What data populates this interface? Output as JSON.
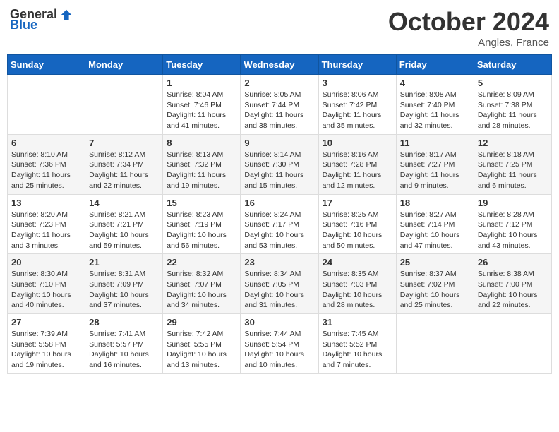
{
  "header": {
    "logo_general": "General",
    "logo_blue": "Blue",
    "month_title": "October 2024",
    "subtitle": "Angles, France"
  },
  "weekdays": [
    "Sunday",
    "Monday",
    "Tuesday",
    "Wednesday",
    "Thursday",
    "Friday",
    "Saturday"
  ],
  "weeks": [
    [
      {
        "day": "",
        "info": ""
      },
      {
        "day": "",
        "info": ""
      },
      {
        "day": "1",
        "info": "Sunrise: 8:04 AM\nSunset: 7:46 PM\nDaylight: 11 hours and 41 minutes."
      },
      {
        "day": "2",
        "info": "Sunrise: 8:05 AM\nSunset: 7:44 PM\nDaylight: 11 hours and 38 minutes."
      },
      {
        "day": "3",
        "info": "Sunrise: 8:06 AM\nSunset: 7:42 PM\nDaylight: 11 hours and 35 minutes."
      },
      {
        "day": "4",
        "info": "Sunrise: 8:08 AM\nSunset: 7:40 PM\nDaylight: 11 hours and 32 minutes."
      },
      {
        "day": "5",
        "info": "Sunrise: 8:09 AM\nSunset: 7:38 PM\nDaylight: 11 hours and 28 minutes."
      }
    ],
    [
      {
        "day": "6",
        "info": "Sunrise: 8:10 AM\nSunset: 7:36 PM\nDaylight: 11 hours and 25 minutes."
      },
      {
        "day": "7",
        "info": "Sunrise: 8:12 AM\nSunset: 7:34 PM\nDaylight: 11 hours and 22 minutes."
      },
      {
        "day": "8",
        "info": "Sunrise: 8:13 AM\nSunset: 7:32 PM\nDaylight: 11 hours and 19 minutes."
      },
      {
        "day": "9",
        "info": "Sunrise: 8:14 AM\nSunset: 7:30 PM\nDaylight: 11 hours and 15 minutes."
      },
      {
        "day": "10",
        "info": "Sunrise: 8:16 AM\nSunset: 7:28 PM\nDaylight: 11 hours and 12 minutes."
      },
      {
        "day": "11",
        "info": "Sunrise: 8:17 AM\nSunset: 7:27 PM\nDaylight: 11 hours and 9 minutes."
      },
      {
        "day": "12",
        "info": "Sunrise: 8:18 AM\nSunset: 7:25 PM\nDaylight: 11 hours and 6 minutes."
      }
    ],
    [
      {
        "day": "13",
        "info": "Sunrise: 8:20 AM\nSunset: 7:23 PM\nDaylight: 11 hours and 3 minutes."
      },
      {
        "day": "14",
        "info": "Sunrise: 8:21 AM\nSunset: 7:21 PM\nDaylight: 10 hours and 59 minutes."
      },
      {
        "day": "15",
        "info": "Sunrise: 8:23 AM\nSunset: 7:19 PM\nDaylight: 10 hours and 56 minutes."
      },
      {
        "day": "16",
        "info": "Sunrise: 8:24 AM\nSunset: 7:17 PM\nDaylight: 10 hours and 53 minutes."
      },
      {
        "day": "17",
        "info": "Sunrise: 8:25 AM\nSunset: 7:16 PM\nDaylight: 10 hours and 50 minutes."
      },
      {
        "day": "18",
        "info": "Sunrise: 8:27 AM\nSunset: 7:14 PM\nDaylight: 10 hours and 47 minutes."
      },
      {
        "day": "19",
        "info": "Sunrise: 8:28 AM\nSunset: 7:12 PM\nDaylight: 10 hours and 43 minutes."
      }
    ],
    [
      {
        "day": "20",
        "info": "Sunrise: 8:30 AM\nSunset: 7:10 PM\nDaylight: 10 hours and 40 minutes."
      },
      {
        "day": "21",
        "info": "Sunrise: 8:31 AM\nSunset: 7:09 PM\nDaylight: 10 hours and 37 minutes."
      },
      {
        "day": "22",
        "info": "Sunrise: 8:32 AM\nSunset: 7:07 PM\nDaylight: 10 hours and 34 minutes."
      },
      {
        "day": "23",
        "info": "Sunrise: 8:34 AM\nSunset: 7:05 PM\nDaylight: 10 hours and 31 minutes."
      },
      {
        "day": "24",
        "info": "Sunrise: 8:35 AM\nSunset: 7:03 PM\nDaylight: 10 hours and 28 minutes."
      },
      {
        "day": "25",
        "info": "Sunrise: 8:37 AM\nSunset: 7:02 PM\nDaylight: 10 hours and 25 minutes."
      },
      {
        "day": "26",
        "info": "Sunrise: 8:38 AM\nSunset: 7:00 PM\nDaylight: 10 hours and 22 minutes."
      }
    ],
    [
      {
        "day": "27",
        "info": "Sunrise: 7:39 AM\nSunset: 5:58 PM\nDaylight: 10 hours and 19 minutes."
      },
      {
        "day": "28",
        "info": "Sunrise: 7:41 AM\nSunset: 5:57 PM\nDaylight: 10 hours and 16 minutes."
      },
      {
        "day": "29",
        "info": "Sunrise: 7:42 AM\nSunset: 5:55 PM\nDaylight: 10 hours and 13 minutes."
      },
      {
        "day": "30",
        "info": "Sunrise: 7:44 AM\nSunset: 5:54 PM\nDaylight: 10 hours and 10 minutes."
      },
      {
        "day": "31",
        "info": "Sunrise: 7:45 AM\nSunset: 5:52 PM\nDaylight: 10 hours and 7 minutes."
      },
      {
        "day": "",
        "info": ""
      },
      {
        "day": "",
        "info": ""
      }
    ]
  ]
}
